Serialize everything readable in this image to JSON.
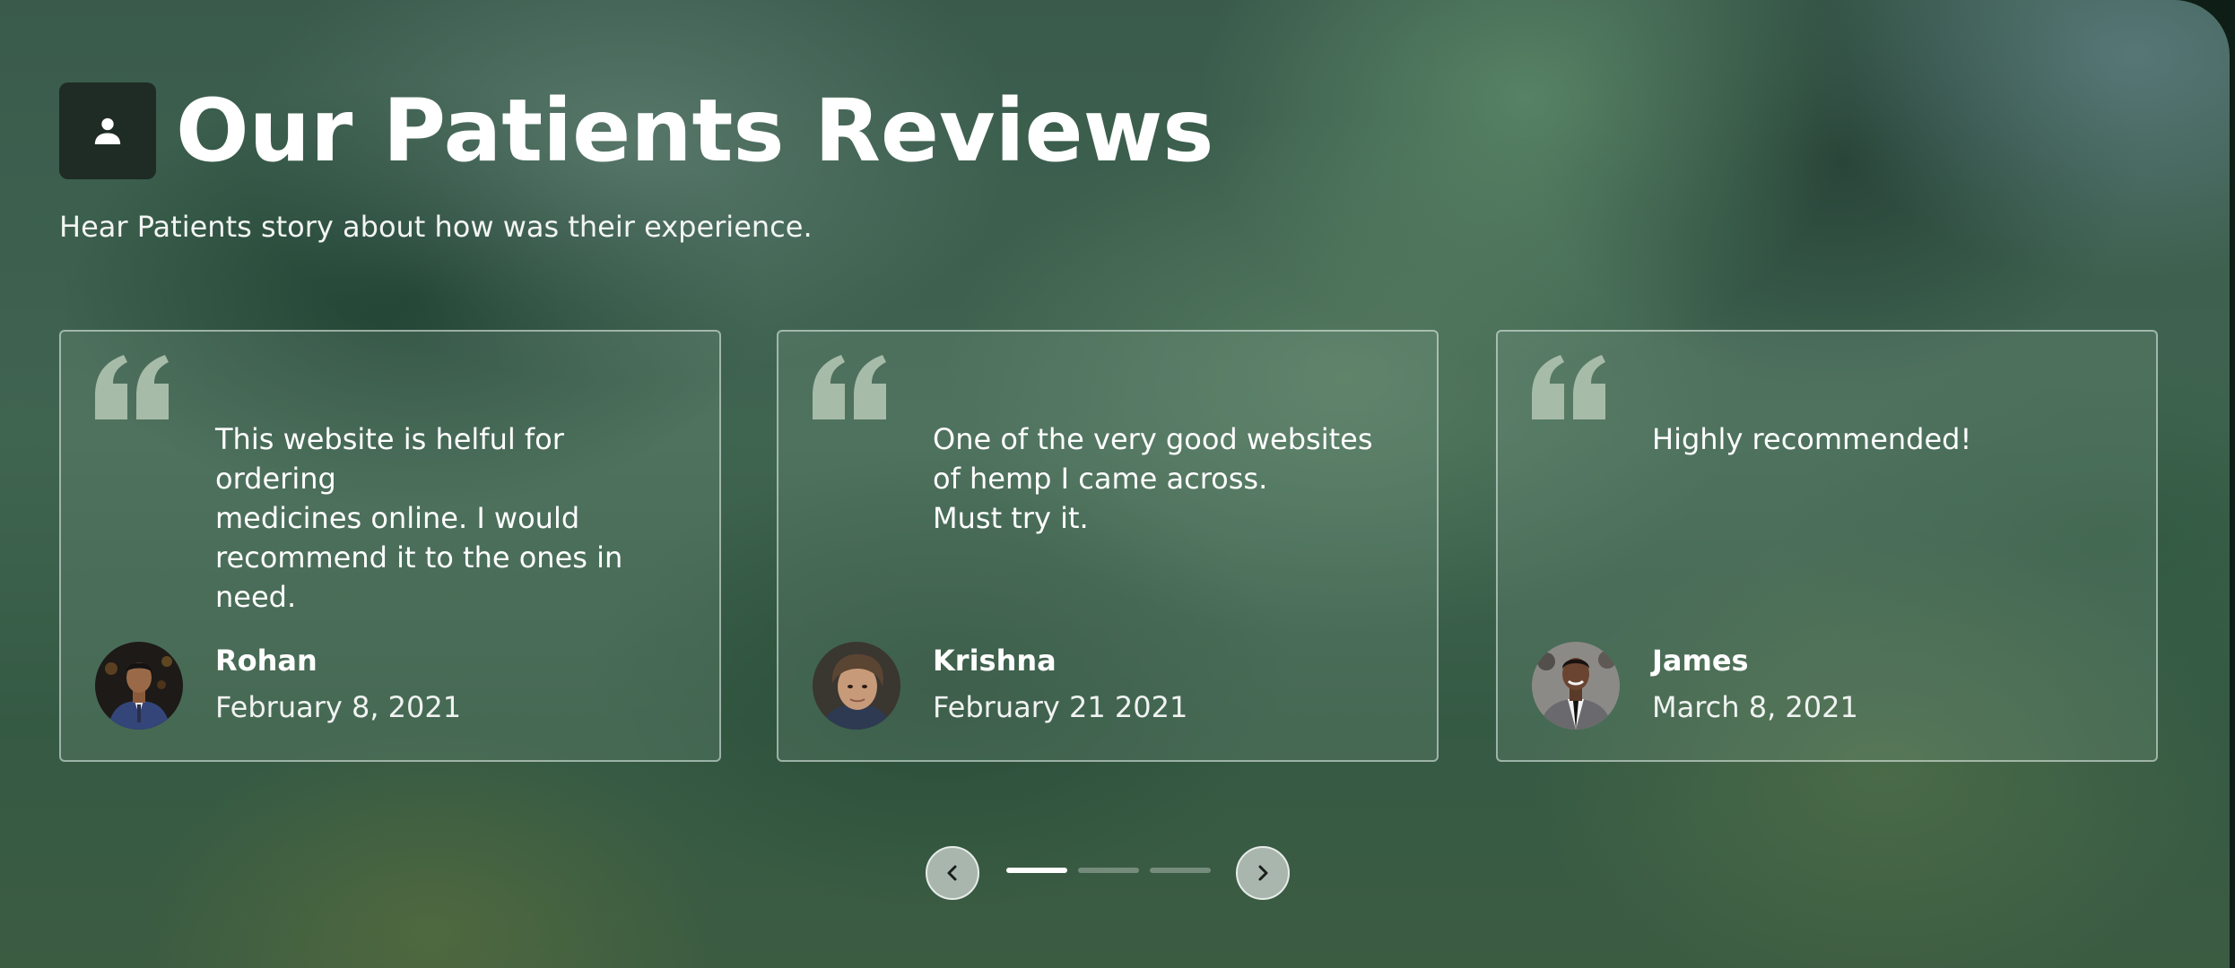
{
  "section": {
    "icon": "person-icon",
    "title": "Our Patients Reviews",
    "subtitle": "Hear Patients story about how was their experience."
  },
  "reviews": [
    {
      "text_lines": [
        "This website is helful for ordering",
        "medicines online. I would",
        "recommend it to the ones in",
        "need."
      ],
      "name": "Rohan",
      "date": "February 8, 2021",
      "avatar": "avatar-rohan"
    },
    {
      "text_lines": [
        "One of the very good websites",
        "of hemp I came across.",
        "Must try it."
      ],
      "name": "Krishna",
      "date": "February 21 2021",
      "avatar": "avatar-krishna"
    },
    {
      "text_lines": [
        "Highly recommended!"
      ],
      "name": "James",
      "date": "March 8, 2021",
      "avatar": "avatar-james"
    }
  ],
  "carousel": {
    "prev_icon": "chevron-left-icon",
    "next_icon": "chevron-right-icon",
    "page_count": 3,
    "active_page": 1
  },
  "colors": {
    "badge_bg": "#1e2c25",
    "text": "#ffffff",
    "quote_mark": "#a6bba8",
    "nav_button_bg": "#a9b6ae"
  }
}
